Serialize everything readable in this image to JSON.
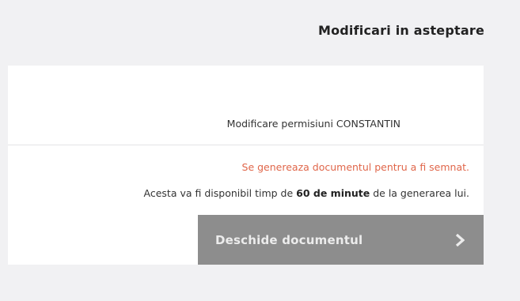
{
  "panel": {
    "title": "Modificari in asteptare"
  },
  "item": {
    "label": "Modificare permisiuni CONSTANTIN"
  },
  "status": {
    "message": "Se genereaza documentul pentru a fi semnat."
  },
  "info": {
    "prefix": "Acesta va fi disponibil timp de ",
    "duration": "60 de minute",
    "suffix": " de la generarea lui."
  },
  "actions": {
    "open_label": "Deschide documentul",
    "open_icon": "chevron-right-icon"
  },
  "colors": {
    "status": "#e0664a",
    "button_bg": "#8d8d8d",
    "button_text": "#ececec",
    "page_bg": "#f1f1f3",
    "card_bg": "#ffffff"
  }
}
